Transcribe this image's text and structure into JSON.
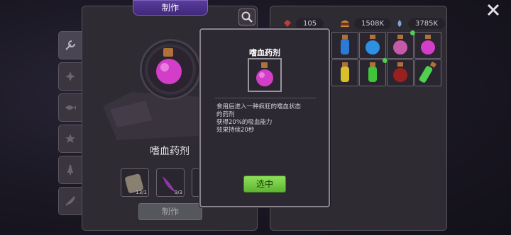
{
  "craft": {
    "header": "制作",
    "item_name": "嗜血药剂",
    "make_label": "制作",
    "ingredients": [
      {
        "count": "13/1"
      },
      {
        "count": "9/3"
      },
      {
        "count": ""
      }
    ]
  },
  "resources": [
    {
      "icon": "red-gem-icon",
      "value": "105"
    },
    {
      "icon": "burger-icon",
      "value": "1508K"
    },
    {
      "icon": "blue-drop-icon",
      "value": "3785K"
    }
  ],
  "modal": {
    "title": "嗜血药剂",
    "desc_lines": [
      "食用后进入一种疯狂的嗜血状态",
      "的药剂",
      "获得20%的吸血能力",
      "效果持续20秒"
    ],
    "select_label": "选中"
  },
  "colors": {
    "accent_purple": "#5a3d9c",
    "select_green": "#7acb45"
  }
}
